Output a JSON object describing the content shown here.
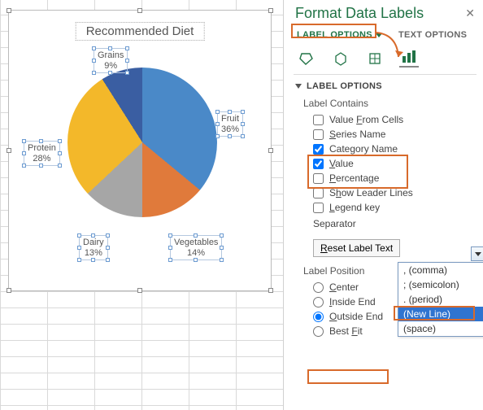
{
  "chart_data": {
    "type": "pie",
    "title": "Recommended Diet",
    "categories": [
      "Fruit",
      "Vegetables",
      "Dairy",
      "Protein",
      "Grains"
    ],
    "values": [
      36,
      14,
      13,
      28,
      9
    ],
    "value_suffix": "%",
    "colors": [
      "#4a89c8",
      "#e07a3b",
      "#a6a6a6",
      "#f3b82a",
      "#3a5ea2"
    ],
    "label_position": "Outside End",
    "label_contains": [
      "Category Name",
      "Value"
    ]
  },
  "pane": {
    "title": "Format Data Labels",
    "tabs": {
      "label_options": "LABEL OPTIONS",
      "text_options": "TEXT OPTIONS",
      "active": "label_options"
    },
    "section": "LABEL OPTIONS",
    "label_contains_header": "Label Contains",
    "options": {
      "value_from_cells": "Value From Cells",
      "series_name": "Series Name",
      "category_name": "Category Name",
      "value": "Value",
      "percentage": "Percentage",
      "show_leader_lines": "Show Leader Lines",
      "legend_key": "Legend key"
    },
    "checks": {
      "value_from_cells": false,
      "series_name": false,
      "category_name": true,
      "value": true,
      "percentage": false,
      "show_leader_lines": false,
      "legend_key": false
    },
    "separator_label": "Separator",
    "separator_options": [
      ", (comma)",
      "; (semicolon)",
      ". (period)",
      "(New Line)",
      "  (space)"
    ],
    "separator_selected": "(New Line)",
    "reset_label": "Reset Label Text",
    "position_header": "Label Position",
    "positions": {
      "center": "Center",
      "inside_end": "Inside End",
      "outside_end": "Outside End",
      "best_fit": "Best Fit"
    },
    "position_selected": "outside_end"
  }
}
